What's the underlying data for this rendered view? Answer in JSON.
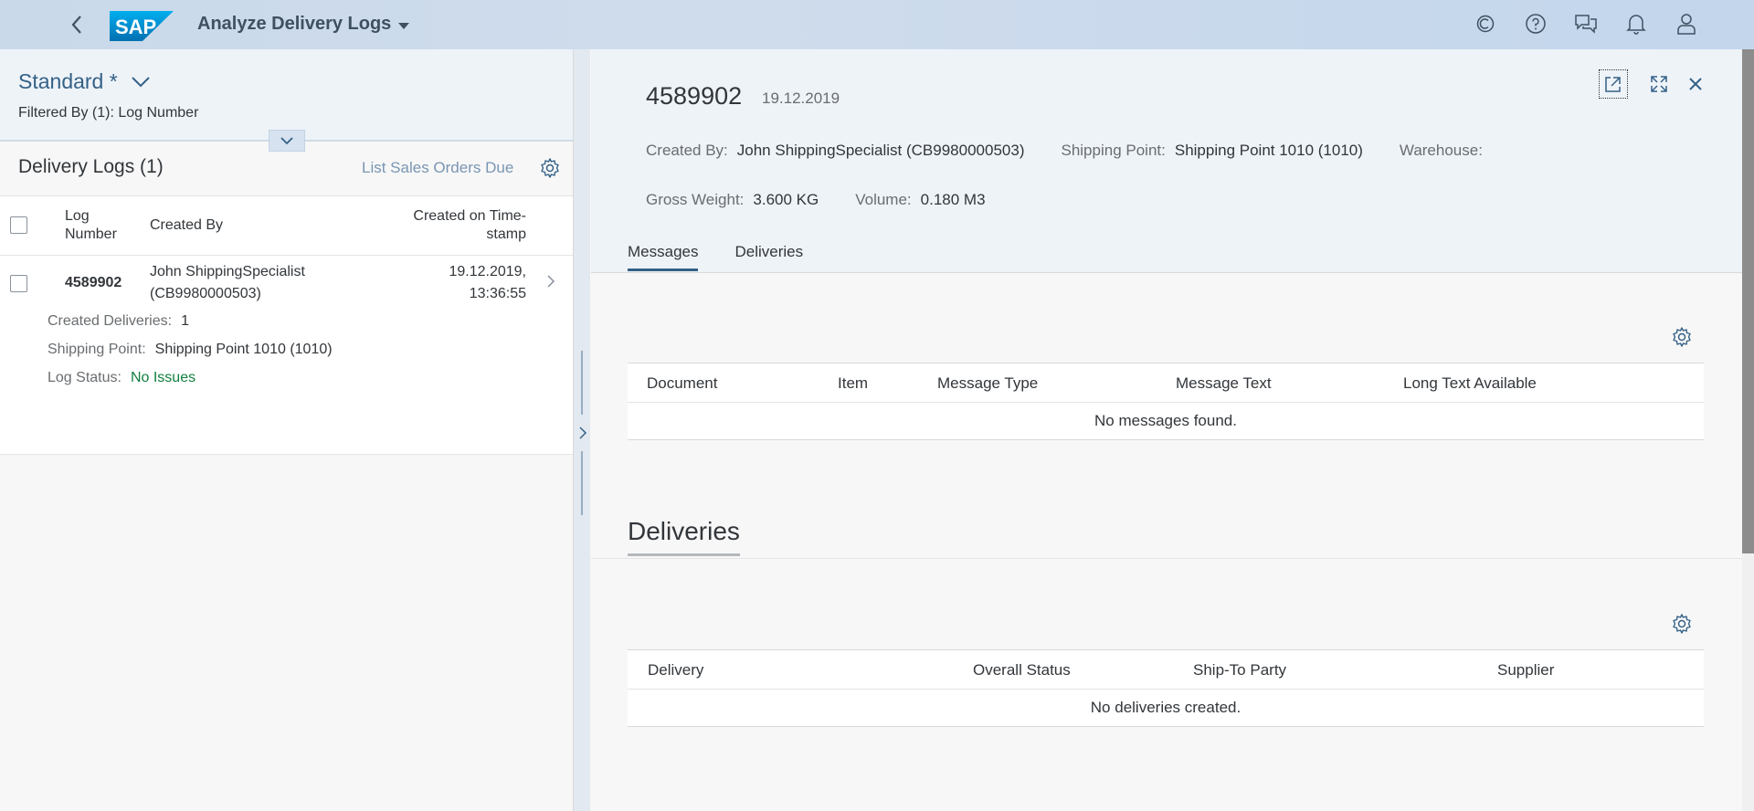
{
  "shell": {
    "app_title": "Analyze Delivery Logs",
    "logo_text": "SAP",
    "icons": [
      "back-icon",
      "copilot-icon",
      "help-icon",
      "feedback-icon",
      "notifications-icon",
      "user-icon"
    ]
  },
  "left": {
    "variant": "Standard *",
    "filtered_by": "Filtered By (1): Log Number",
    "list_title": "Delivery Logs (1)",
    "list_sales_label": "List Sales Orders Due",
    "columns": {
      "log_number_1": "Log",
      "log_number_2": "Number",
      "created_by": "Created By",
      "created_on_1": "Created on Time-",
      "created_on_2": "stamp"
    },
    "rows": [
      {
        "log_number": "4589902",
        "created_by_1": "John ShippingSpecialist",
        "created_by_2": "(CB9980000503)",
        "created_on_1": "19.12.2019,",
        "created_on_2": "13:36:55",
        "created_deliveries_label": "Created Deliveries:",
        "created_deliveries": "1",
        "shipping_point_label": "Shipping Point:",
        "shipping_point": "Shipping Point 1010 (1010)",
        "log_status_label": "Log Status:",
        "log_status": "No Issues"
      }
    ]
  },
  "detail": {
    "title": "4589902",
    "date": "19.12.2019",
    "created_by_label": "Created By:",
    "created_by": "John ShippingSpecialist (CB9980000503)",
    "shipping_point_label": "Shipping Point:",
    "shipping_point": "Shipping Point 1010 (1010)",
    "warehouse_label": "Warehouse:",
    "gross_weight_label": "Gross Weight:",
    "gross_weight": "3.600 KG",
    "volume_label": "Volume:",
    "volume": "0.180 M3",
    "tabs": [
      "Messages",
      "Deliveries"
    ],
    "messages_table": {
      "columns": [
        "Document",
        "Item",
        "Message Type",
        "Message Text",
        "Long Text Available"
      ],
      "empty_text": "No messages found."
    },
    "deliveries_section_title": "Deliveries",
    "deliveries_table": {
      "columns": [
        "Delivery",
        "Overall Status",
        "Ship-To Party",
        "Supplier"
      ],
      "empty_text": "No deliveries created."
    }
  },
  "colors": {
    "brand": "#346187",
    "status_positive": "#107e3e",
    "shell_bg": "#c9d9ea"
  }
}
